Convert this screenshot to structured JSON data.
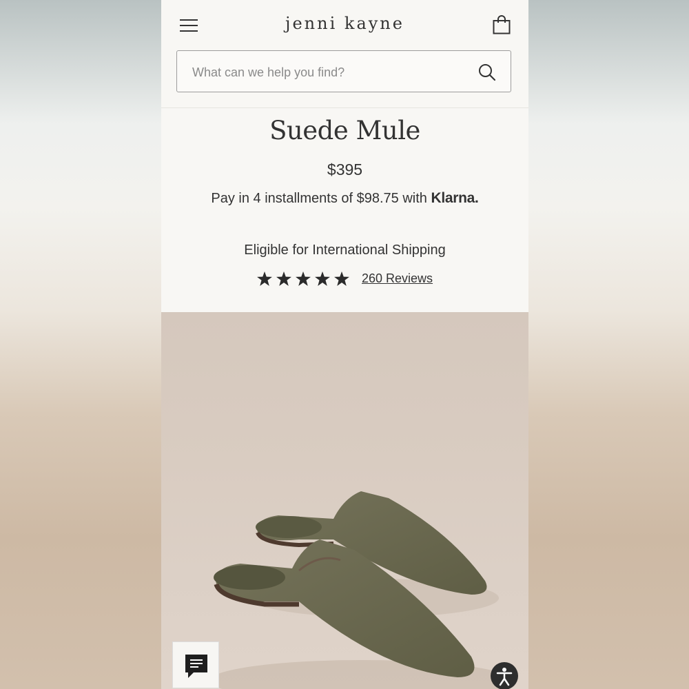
{
  "header": {
    "logo": "jenni kayne"
  },
  "search": {
    "placeholder": "What can we help you find?"
  },
  "product": {
    "title": "Suede Mule",
    "price": "$395",
    "installments_text": "Pay in 4 installments of $98.75 with",
    "installments_brand": "Klarna.",
    "shipping": "Eligible for International Shipping",
    "rating_stars": 5,
    "reviews_label": "260 Reviews"
  },
  "icons": {
    "menu": "menu-icon",
    "bag": "shopping-bag-icon",
    "search": "search-icon",
    "star": "star-icon",
    "chat": "chat-icon",
    "accessibility": "accessibility-icon"
  },
  "colors": {
    "text": "#333333",
    "page_bg": "#f8f7f4",
    "shoe": "#6b6a4e"
  }
}
